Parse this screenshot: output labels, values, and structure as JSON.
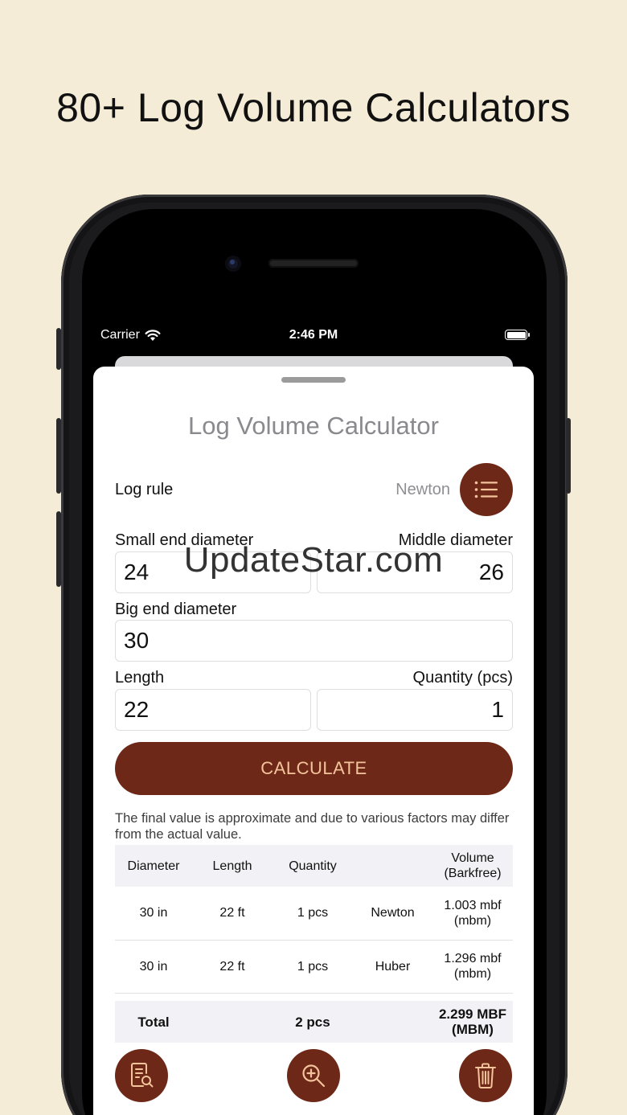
{
  "promo": {
    "headline": "80+ Log Volume Calculators"
  },
  "status_bar": {
    "carrier": "Carrier",
    "time": "2:46 PM"
  },
  "app": {
    "title": "Log Volume Calculator",
    "log_rule": {
      "label": "Log rule",
      "value": "Newton"
    },
    "fields": {
      "small_end_diameter": {
        "label": "Small end diameter",
        "value": "24"
      },
      "middle_diameter": {
        "label": "Middle diameter",
        "value": "26"
      },
      "big_end_diameter": {
        "label": "Big end diameter",
        "value": "30"
      },
      "length": {
        "label": "Length",
        "value": "22"
      },
      "quantity": {
        "label": "Quantity (pcs)",
        "value": "1"
      }
    },
    "calculate_label": "CALCULATE",
    "note": "The final value is approximate and due to various factors may differ from the actual value.",
    "table": {
      "headers": [
        "Diameter",
        "Length",
        "Quantity",
        "",
        "Volume\n(Barkfree)"
      ],
      "rows": [
        {
          "diameter": "30 in",
          "length": "22 ft",
          "quantity": "1 pcs",
          "rule": "Newton",
          "volume": "1.003 mbf (mbm)"
        },
        {
          "diameter": "30 in",
          "length": "22 ft",
          "quantity": "1 pcs",
          "rule": "Huber",
          "volume": "1.296 mbf (mbm)"
        }
      ],
      "total": {
        "label": "Total",
        "quantity": "2 pcs",
        "volume": "2.299 MBF (MBM)"
      }
    },
    "bottom_actions": [
      "report-icon",
      "zoom-in-icon",
      "trash-icon"
    ]
  },
  "watermark": "UpdateStar.com",
  "colors": {
    "background": "#f4ecd6",
    "accent": "#6e2818",
    "button_text": "#f3c49b"
  }
}
